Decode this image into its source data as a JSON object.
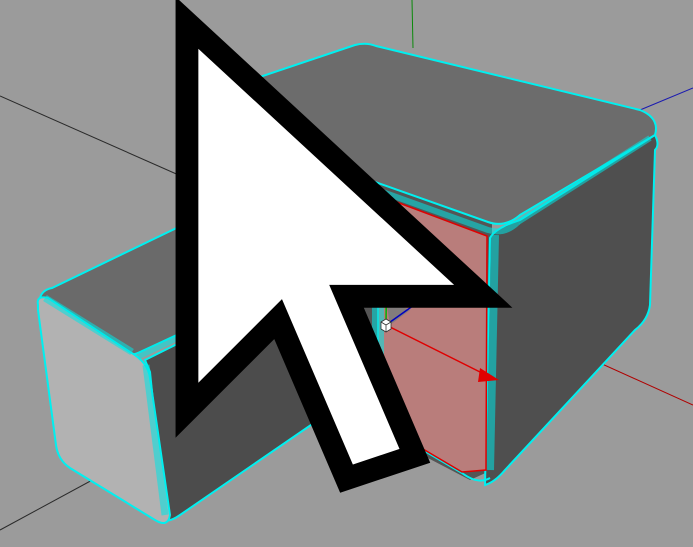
{
  "viewport": {
    "background": "#9b9b9b",
    "grid_line_color": "#2a2a2a"
  },
  "axes": {
    "x_color": "#c00000",
    "y_color": "#00aa00",
    "z_color": "#0000c8"
  },
  "scene": {
    "object_face_light": "#b4b4b4",
    "object_face_top": "#6d6d6d",
    "object_face_side": "#4f4f4f",
    "object_face_front_dark": "#545454",
    "selection_edge_color": "#00f0f0",
    "selected_polygon_color": "#b97d7b",
    "selected_polygon_edge": "#e00000"
  },
  "gizmo": {
    "x_axis_color": "#e00000",
    "y_axis_color": "#00b000",
    "z_axis_color": "#0000c0",
    "center_icon": "cube-icon"
  },
  "cursor": {
    "icon": "arrow-cursor-icon"
  }
}
